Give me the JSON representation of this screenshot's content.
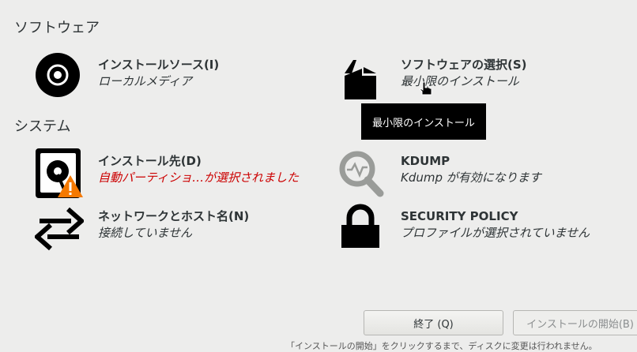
{
  "sections": {
    "software": "ソフトウェア",
    "system": "システム"
  },
  "spokes": {
    "install_source": {
      "title": "インストールソース(I)",
      "status": "ローカルメディア"
    },
    "software_selection": {
      "title": "ソフトウェアの選択(S)",
      "status": "最小限のインストール"
    },
    "install_destination": {
      "title": "インストール先(D)",
      "status": "自動パーティショ…が選択されました"
    },
    "kdump": {
      "title": "KDUMP",
      "status": "Kdump が有効になります"
    },
    "network": {
      "title": "ネットワークとホスト名(N)",
      "status": "接続していません"
    },
    "security_policy": {
      "title": "SECURITY POLICY",
      "status": "プロファイルが選択されていません"
    }
  },
  "tooltip": "最小限のインストール",
  "buttons": {
    "quit": "終了 (Q)",
    "begin": "インストールの開始(B)"
  },
  "footnote": "「インストールの開始」をクリックするまで、ディスクに変更は行われません。",
  "colors": {
    "background": "#ededec",
    "error": "#cc0000",
    "warning": "#f57900"
  }
}
